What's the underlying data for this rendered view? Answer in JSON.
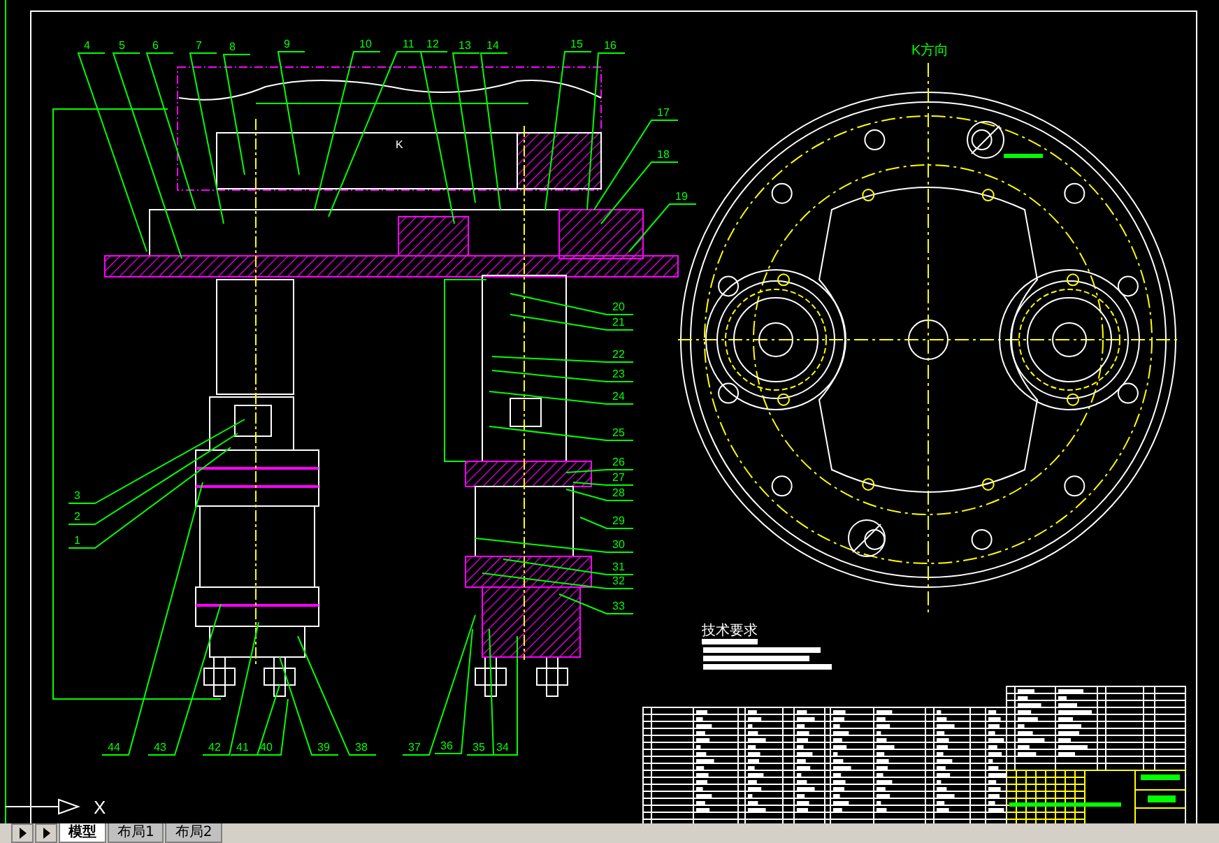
{
  "view_label": "K方向",
  "section_marker": "K",
  "balloons": [
    {
      "label": "4"
    },
    {
      "label": "5"
    },
    {
      "label": "6"
    },
    {
      "label": "7"
    },
    {
      "label": "8"
    },
    {
      "label": "9"
    },
    {
      "label": "10"
    },
    {
      "label": "11"
    },
    {
      "label": "12"
    },
    {
      "label": "13"
    },
    {
      "label": "14"
    },
    {
      "label": "15"
    },
    {
      "label": "16"
    },
    {
      "label": "17"
    },
    {
      "label": "18"
    },
    {
      "label": "19"
    },
    {
      "label": "20"
    },
    {
      "label": "21"
    },
    {
      "label": "22"
    },
    {
      "label": "23"
    },
    {
      "label": "24"
    },
    {
      "label": "25"
    },
    {
      "label": "26"
    },
    {
      "label": "27"
    },
    {
      "label": "28"
    },
    {
      "label": "29"
    },
    {
      "label": "30"
    },
    {
      "label": "31"
    },
    {
      "label": "32"
    },
    {
      "label": "33"
    },
    {
      "label": "3"
    },
    {
      "label": "2"
    },
    {
      "label": "1"
    },
    {
      "label": "44"
    },
    {
      "label": "43"
    },
    {
      "label": "42"
    },
    {
      "label": "41"
    },
    {
      "label": "40"
    },
    {
      "label": "39"
    },
    {
      "label": "38"
    },
    {
      "label": "37"
    },
    {
      "label": "36"
    },
    {
      "label": "35"
    },
    {
      "label": "34"
    }
  ],
  "notes_title": "技术要求",
  "ucs": {
    "x_label": "X"
  },
  "layout_tabs": [
    {
      "label": "模型",
      "selected": true
    },
    {
      "label": "布局1",
      "selected": false
    },
    {
      "label": "布局2",
      "selected": false
    }
  ]
}
